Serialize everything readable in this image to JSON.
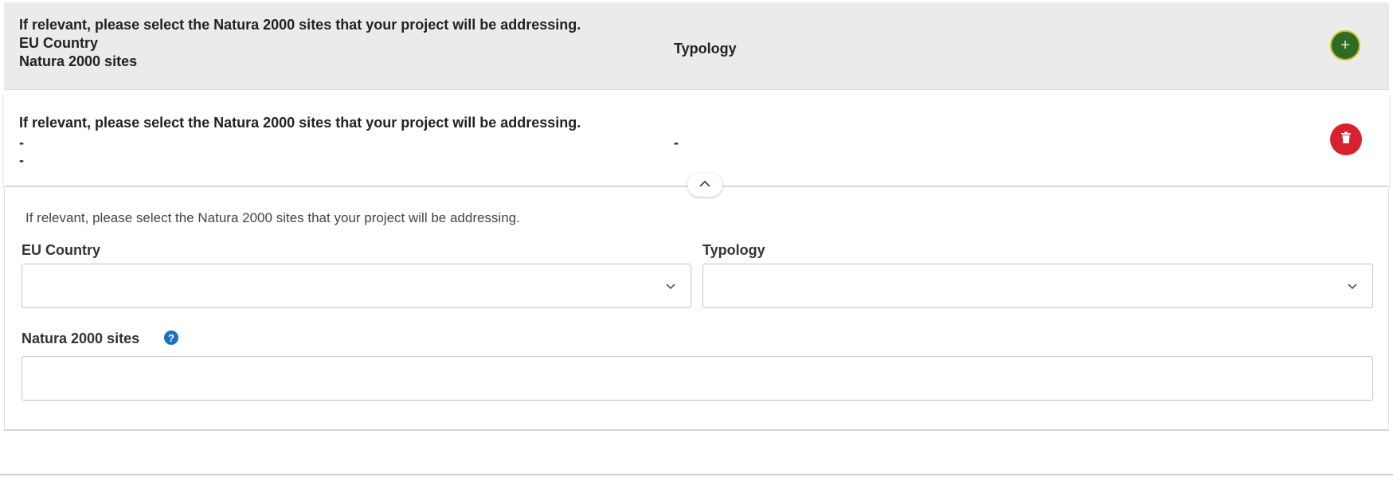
{
  "header": {
    "description": "If relevant, please select the Natura 2000 sites that your project will be addressing.",
    "col_country": "EU Country",
    "col_sites": "Natura 2000 sites",
    "col_typology": "Typology",
    "add_icon": "plus-icon",
    "add_color": "#2f6b26"
  },
  "entry": {
    "description": "If relevant, please select the Natura 2000 sites that your project will be addressing.",
    "country": "-",
    "sites": "-",
    "typology": "-",
    "delete_icon": "trash-icon",
    "delete_color": "#d8212f"
  },
  "toggle": {
    "icon": "chevron-up-icon"
  },
  "form": {
    "description": "If relevant, please select the Natura 2000 sites that your project will be addressing.",
    "country_label": "EU Country",
    "country_value": "",
    "typology_label": "Typology",
    "typology_value": "",
    "sites_label": "Natura 2000 sites",
    "sites_value": "",
    "help_icon": "question-icon",
    "help_color": "#1a73c2"
  }
}
